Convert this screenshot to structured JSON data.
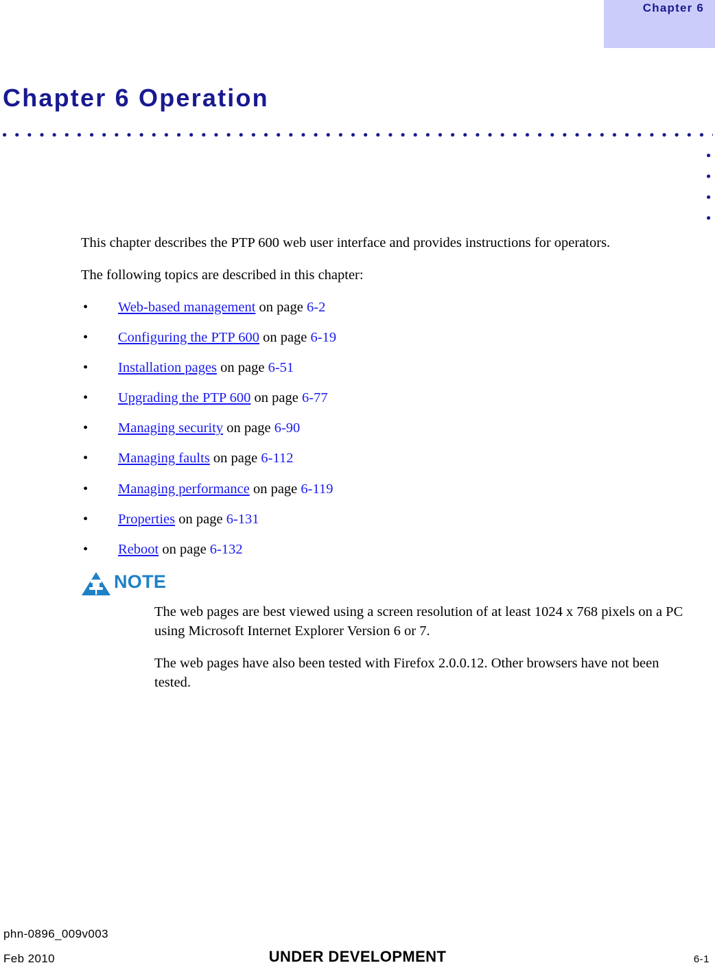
{
  "running_header": {
    "chapter_label": "Chapter 6"
  },
  "title": "Chapter 6 Operation",
  "intro": {
    "paragraph_1": "This chapter describes the PTP 600 web user interface and provides instructions for operators.",
    "paragraph_2": "The following topics are described in this chapter:"
  },
  "topics": [
    {
      "bullet": "•",
      "link": "Web-based management",
      "on_page": " on page ",
      "page": "6-2"
    },
    {
      "bullet": "•",
      "link": "Configuring the PTP 600",
      "on_page": " on page ",
      "page": "6-19"
    },
    {
      "bullet": "•",
      "link": "Installation pages",
      "on_page": " on page ",
      "page": "6-51"
    },
    {
      "bullet": "•",
      "link": "Upgrading the PTP 600",
      "on_page": " on page ",
      "page": "6-77"
    },
    {
      "bullet": "•",
      "link": "Managing security",
      "on_page": " on page ",
      "page": "6-90"
    },
    {
      "bullet": "•",
      "link": "Managing faults",
      "on_page": " on page ",
      "page": "6-112"
    },
    {
      "bullet": "•",
      "link": "Managing performance",
      "on_page": " on page ",
      "page": "6-119"
    },
    {
      "bullet": "•",
      "link": "Properties",
      "on_page": " on page ",
      "page": "6-131"
    },
    {
      "bullet": "•",
      "link": "Reboot",
      "on_page": " on page ",
      "page": "6-132"
    }
  ],
  "note": {
    "label": "NOTE",
    "icon": "note-triangle-pushpin-icon",
    "paragraph_1": "The web pages are best viewed using a screen resolution of at least 1024 x 768 pixels on a PC using Microsoft Internet Explorer Version 6 or 7.",
    "paragraph_2": "The web pages have also been tested with Firefox 2.0.0.12. Other browsers have not been tested."
  },
  "footer": {
    "document_id": "phn-0896_009v003",
    "date": "Feb 2010",
    "status": "UNDER DEVELOPMENT",
    "page_number": "6-1"
  },
  "colors": {
    "header_box_fill": "#ccccfa",
    "heading_blue": "#191991",
    "link_blue": "#1a1aee",
    "note_blue": "#1e81c6",
    "body_text": "#000000"
  }
}
